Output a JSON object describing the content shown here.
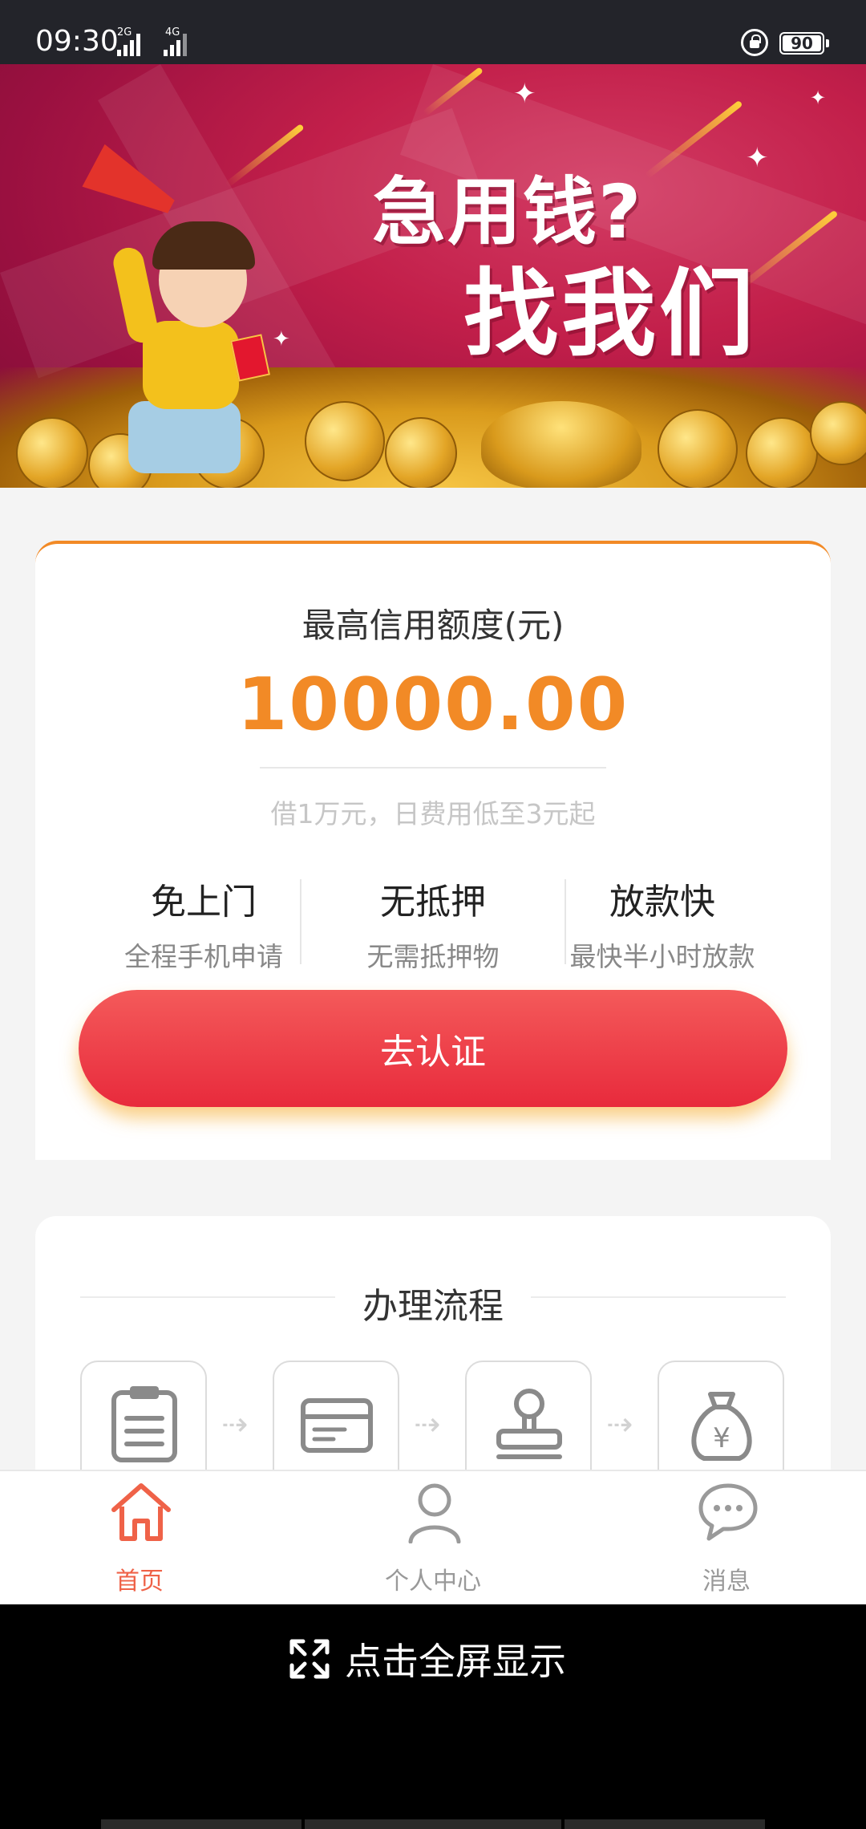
{
  "status_bar": {
    "time": "09:30",
    "network_left": "2G",
    "network_right": "4G",
    "volte": "4G",
    "battery_percent": 90
  },
  "banner": {
    "headline_1": "急用钱?",
    "headline_2": "找我们"
  },
  "credit": {
    "label": "最高信用额度(元)",
    "amount": "10000.00",
    "note": "借1万元，日费用低至3元起"
  },
  "features": [
    {
      "title": "免上门",
      "subtitle": "全程手机申请"
    },
    {
      "title": "无抵押",
      "subtitle": "无需抵押物"
    },
    {
      "title": "放款快",
      "subtitle": "最快半小时放款"
    }
  ],
  "cta": {
    "label": "去认证"
  },
  "process": {
    "title": "办理流程",
    "steps": [
      {
        "icon": "clipboard-icon"
      },
      {
        "icon": "card-icon"
      },
      {
        "icon": "stamp-icon"
      },
      {
        "icon": "money-bag-icon"
      }
    ],
    "arrow": "⇢"
  },
  "tabs": [
    {
      "label": "首页",
      "icon": "home-icon",
      "active": true
    },
    {
      "label": "个人中心",
      "icon": "user-icon",
      "active": false
    },
    {
      "label": "消息",
      "icon": "message-icon",
      "active": false
    }
  ],
  "fullscreen": {
    "label": "点击全屏显示",
    "icon": "expand-icon"
  },
  "colors": {
    "accent_orange": "#f28a26",
    "button_red": "#e82a3c",
    "tab_active": "#ef6248",
    "status_bar": "#23242a"
  }
}
